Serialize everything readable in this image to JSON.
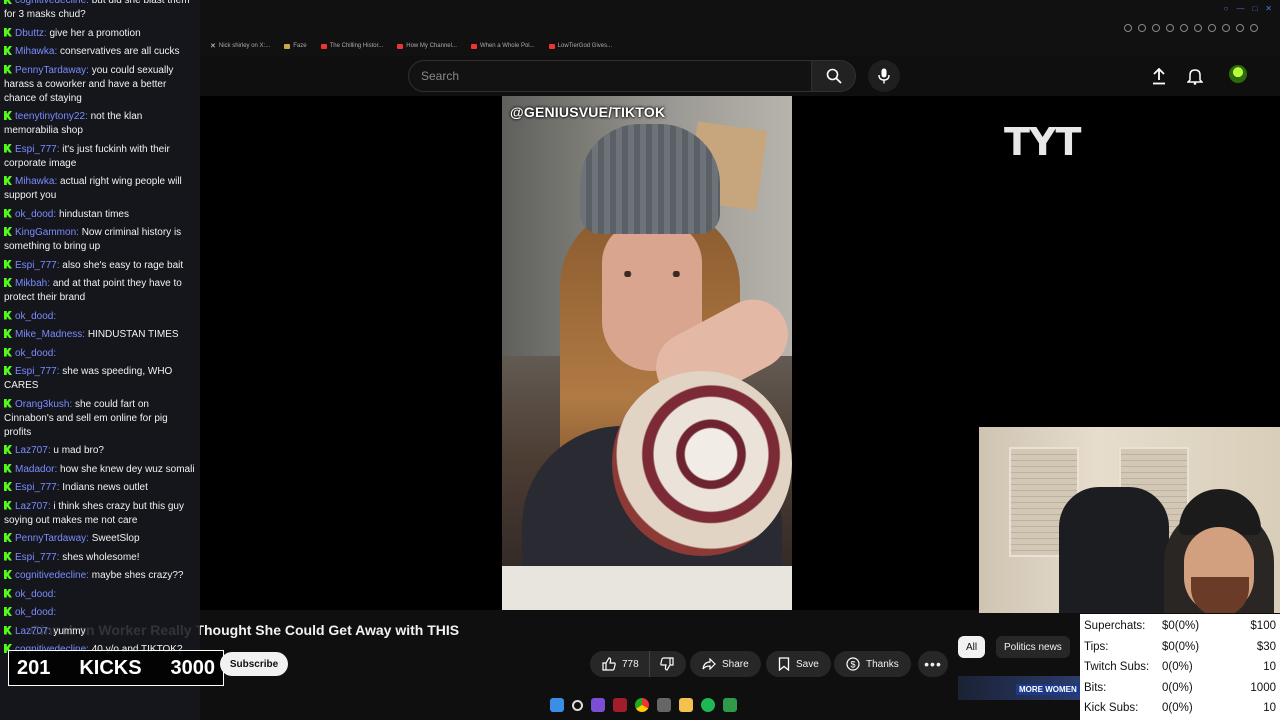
{
  "chat": {
    "messages": [
      {
        "user": "cognitivedecline",
        "text": "but did she blast them for 3 masks chud?"
      },
      {
        "user": "Dbuttz",
        "text": "give her a promotion"
      },
      {
        "user": "Mihawka",
        "text": "conservatives are all cucks"
      },
      {
        "user": "PennyTardaway",
        "text": "you could sexually harass a coworker and have a better chance of staying"
      },
      {
        "user": "teenytinytony22",
        "text": "not the klan memorabilia shop"
      },
      {
        "user": "Espi_777",
        "text": "it's just fuckinh with their corporate image"
      },
      {
        "user": "Mihawka",
        "text": "actual right wing people will support you"
      },
      {
        "user": "ok_dood",
        "text": "hindustan times"
      },
      {
        "user": "KingGammon",
        "text": "Now criminal history is something to bring up"
      },
      {
        "user": "Espi_777",
        "text": "also she's easy to rage bait"
      },
      {
        "user": "Mikbah",
        "text": "and at that point they have to protect their brand"
      },
      {
        "user": "ok_dood",
        "text": ""
      },
      {
        "user": "Mike_Madness",
        "text": "HINDUSTAN TIMES"
      },
      {
        "user": "ok_dood",
        "text": ""
      },
      {
        "user": "Espi_777",
        "text": "she was speeding, WHO CARES"
      },
      {
        "user": "Orang3kush",
        "text": "she could fart on Cinnabon's and sell em online for pig profits"
      },
      {
        "user": "Laz707",
        "text": "u mad bro?"
      },
      {
        "user": "Madador",
        "text": "how she knew dey wuz somali"
      },
      {
        "user": "Espi_777",
        "text": "Indians news outlet"
      },
      {
        "user": "Laz707",
        "text": "i think shes crazy but this guy soying out makes me not care"
      },
      {
        "user": "PennyTardaway",
        "text": "SweetSlop"
      },
      {
        "user": "Espi_777",
        "text": "shes wholesome!"
      },
      {
        "user": "cognitivedecline",
        "text": "maybe shes crazy??"
      },
      {
        "user": "ok_dood",
        "text": ""
      },
      {
        "user": "ok_dood",
        "text": ""
      },
      {
        "user": "Laz707",
        "text": "yummy"
      },
      {
        "user": "cognitivedecline",
        "text": "40 y/o and TIKTOK?"
      }
    ]
  },
  "browser": {
    "bookmarks": [
      {
        "label": "Nick shirley on X:...",
        "kind": "x"
      },
      {
        "label": "Faze",
        "kind": "folder"
      },
      {
        "label": "The Chilling Histor...",
        "kind": "yt"
      },
      {
        "label": "How My Channel...",
        "kind": "yt"
      },
      {
        "label": "When a Whole Pol...",
        "kind": "yt"
      },
      {
        "label": "LowTierGod Gives...",
        "kind": "yt"
      }
    ]
  },
  "search": {
    "placeholder": "Search"
  },
  "video": {
    "watermark": "@GENIUSVUE/TIKTOK",
    "channel_logo": "TYT",
    "title": "Cinnabon Worker Really Thought She Could Get Away with THIS",
    "likes": "778",
    "share_label": "Share",
    "save_label": "Save",
    "thanks_label": "Thanks",
    "subscribe_label": "Subscribe"
  },
  "chips": {
    "all": "All",
    "politics": "Politics news"
  },
  "kick_counter": {
    "current": "201",
    "label": "KICKS",
    "goal": "3000"
  },
  "stats": [
    {
      "label": "Superchats:",
      "count": "$0(0%)",
      "target": "$100"
    },
    {
      "label": "Tips:",
      "count": "$0(0%)",
      "target": "$30"
    },
    {
      "label": "Twitch Subs:",
      "count": "0(0%)",
      "target": "10"
    },
    {
      "label": "Bits:",
      "count": "0(0%)",
      "target": "1000"
    },
    {
      "label": "Kick Subs:",
      "count": "0(0%)",
      "target": "10"
    }
  ],
  "thumbnail": {
    "label": "MORE WOMEN"
  },
  "colors": {
    "kick_green": "#53fc18",
    "username_blue": "#7b8cff",
    "yt_background": "#0f0f0f"
  }
}
